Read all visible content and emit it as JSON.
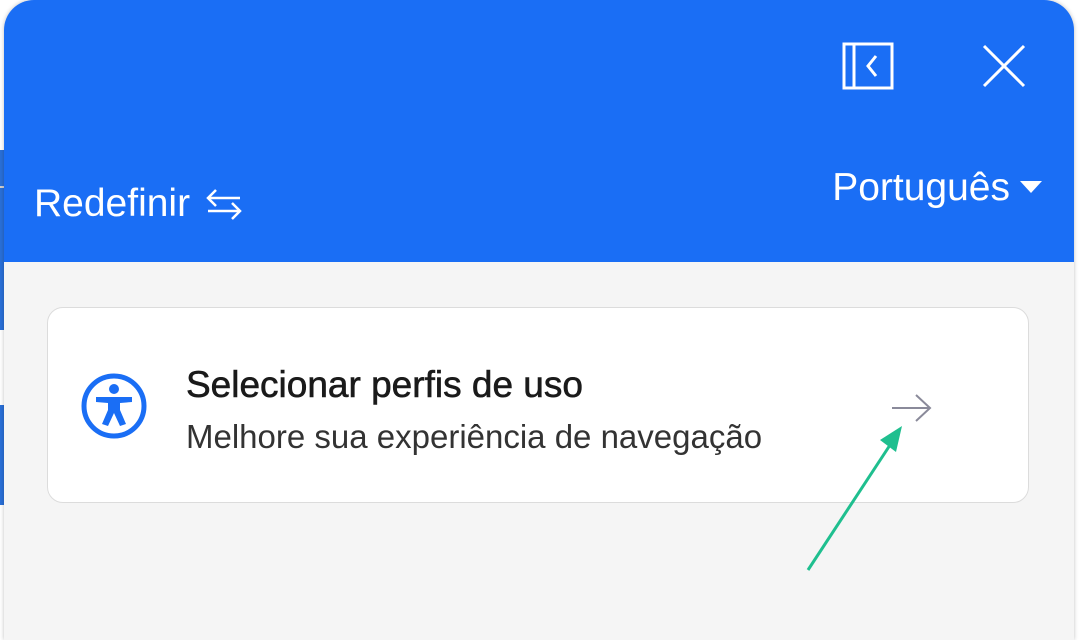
{
  "header": {
    "collapse_icon": "collapse-panel-icon",
    "close_icon": "close-icon",
    "reset_label": "Redefinir",
    "reset_icon": "swap-arrows-icon",
    "language_label": "Português",
    "language_icon": "caret-down-icon"
  },
  "card": {
    "icon": "accessibility-person-icon",
    "title": "Selecionar perfis de uso",
    "subtitle": "Melhore sua experiência de navegação",
    "arrow_icon": "arrow-right-icon"
  },
  "colors": {
    "header_bg": "#1a6ef5",
    "panel_bg": "#f5f5f5",
    "card_bg": "#ffffff",
    "accent": "#1a6ef5",
    "annotation_arrow": "#1fbf8f"
  }
}
